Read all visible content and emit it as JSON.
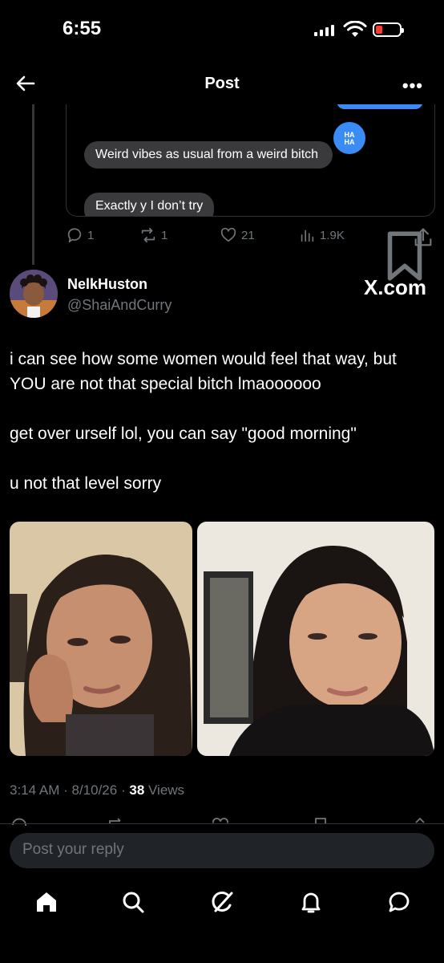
{
  "status": {
    "time": "6:55"
  },
  "header": {
    "title": "Post",
    "more": "•••"
  },
  "quoted": {
    "reaction": "HA\nHA",
    "messages": [
      "Weird vibes as usual from a weird bitch",
      "Exactly y I don’t try"
    ],
    "actions": {
      "replies": "1",
      "reposts": "1",
      "likes": "21",
      "views": "1.9K"
    }
  },
  "tweet": {
    "display_name": "NelkHuston",
    "handle": "@ShaiAndCurry",
    "source_badge": "X.com",
    "paragraphs": [
      "i can see how some women would feel that way, but YOU are not that special bitch lmaoooooo",
      "get over urself lol, you can say \"good morning\"",
      "u not that level sorry"
    ],
    "time": "3:14 AM",
    "date": "8/10/26",
    "views_count": "38",
    "views_label": "Views"
  },
  "reply": {
    "placeholder": "Post your reply"
  },
  "nav": [
    "home-icon",
    "search-icon",
    "grok-icon",
    "notifications-icon",
    "messages-icon"
  ],
  "colors": {
    "background": "#000000",
    "accent": "#1d9bf0",
    "secondary_text": "#71767b",
    "bubble": "#3a3a3c"
  }
}
